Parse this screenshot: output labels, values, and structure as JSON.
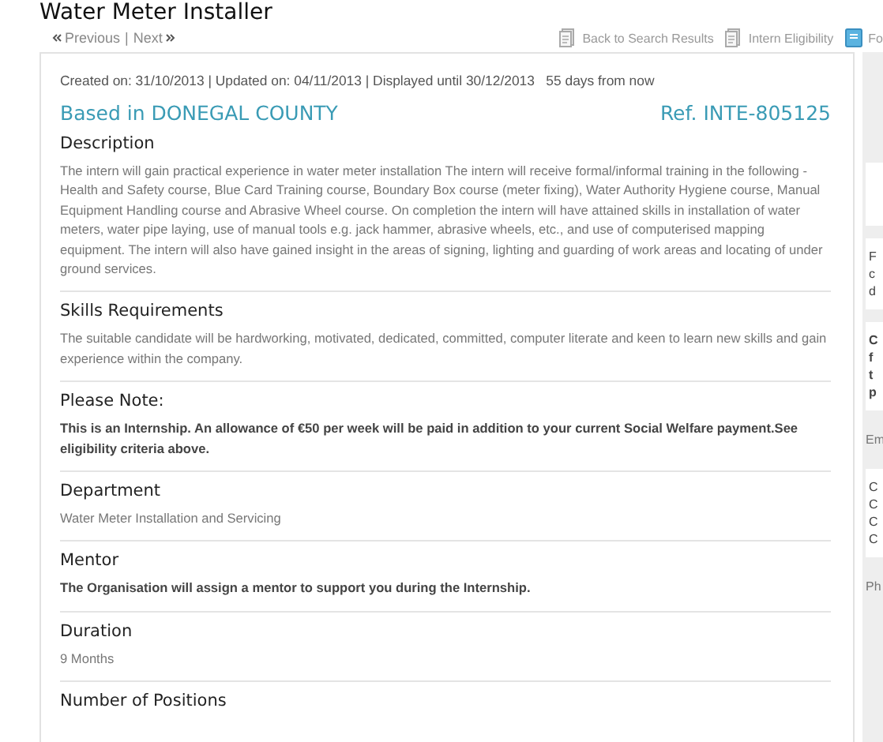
{
  "title": "Water Meter Installer",
  "nav": {
    "previous": "Previous",
    "separator": "|",
    "next": "Next"
  },
  "actions": [
    {
      "label": "Back to Search Results",
      "kind": "doc"
    },
    {
      "label": "Intern Eligibility",
      "kind": "doc"
    },
    {
      "label": "Fo",
      "kind": "blue"
    }
  ],
  "meta": "Created on: 31/10/2013 | Updated on: 04/11/2013 | Displayed until 30/12/2013   55 days from now",
  "location": "Based in DONEGAL COUNTY",
  "reference": "Ref. INTE-805125",
  "sections": [
    {
      "heading": "Description",
      "body": "The intern will gain practical experience in water meter installation The intern will receive formal/informal training in the following - Health and Safety course, Blue Card Training course, Boundary Box course (meter fixing), Water Authority Hygiene course, Manual Equipment Handling course and Abrasive Wheel course. On completion the intern will have attained skills in installation of water meters, water pipe laying, use of manual tools e.g. jack hammer, abrasive wheels, etc., and use of computerised mapping equipment. The intern will also have gained insight in the areas of signing, lighting and guarding of work areas and locating of under ground services.",
      "bold": false
    },
    {
      "heading": "Skills Requirements",
      "body": "The suitable candidate will be hardworking, motivated, dedicated, committed, computer literate and keen to learn new skills and gain experience within the company.",
      "bold": false
    },
    {
      "heading": "Please Note:",
      "body": "This is an Internship. An allowance of €50 per week will be paid in addition to your current Social Welfare payment.See eligibility criteria above.",
      "bold": true
    },
    {
      "heading": "Department",
      "body": "Water Meter Installation and Servicing",
      "bold": false
    },
    {
      "heading": "Mentor",
      "body": "The Organisation will assign a mentor to support you during the Internship.",
      "bold": true
    },
    {
      "heading": "Duration",
      "body": "9 Months",
      "bold": false
    },
    {
      "heading": "Number of Positions"
    }
  ],
  "sidebar": [
    {
      "kind": "box"
    },
    {
      "kind": "box",
      "lines": [
        "F",
        "c",
        "d"
      ],
      "bold": false
    },
    {
      "kind": "box",
      "lines": [
        "C",
        "f",
        "t",
        "p"
      ],
      "bold": true
    },
    {
      "kind": "label",
      "text": "Em"
    },
    {
      "kind": "box",
      "lines": [
        "C",
        "C",
        "C",
        "C"
      ]
    },
    {
      "kind": "label",
      "text": "Ph"
    }
  ]
}
